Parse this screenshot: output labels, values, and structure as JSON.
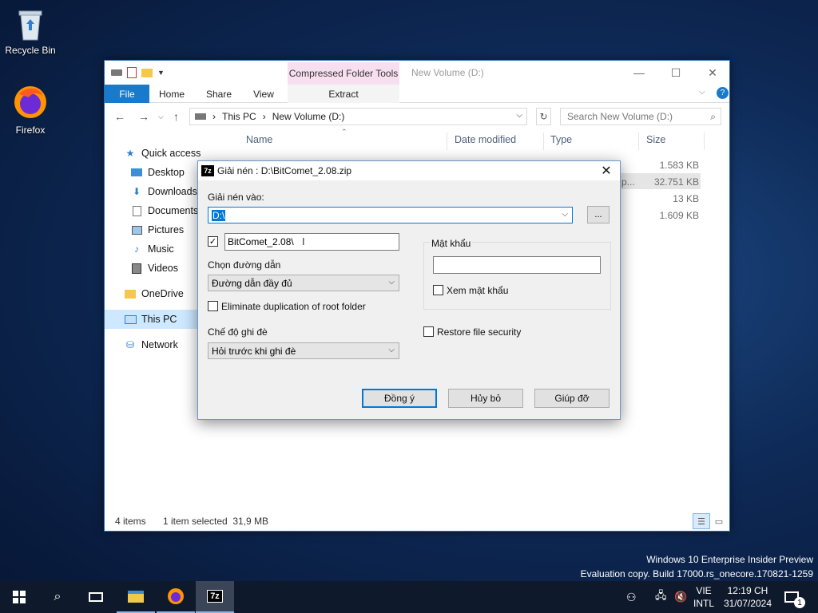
{
  "desktop": {
    "icons": [
      {
        "label": "Recycle Bin",
        "icon": "recycle-bin-icon"
      },
      {
        "label": "Firefox",
        "icon": "firefox-icon"
      }
    ],
    "watermark": {
      "line1": "Windows 10 Enterprise Insider Preview",
      "line2": "Evaluation copy. Build 17000.rs_onecore.170821-1259"
    }
  },
  "explorer": {
    "title": "New Volume (D:)",
    "contextual_tab": "Compressed Folder Tools",
    "ribbon_tabs": [
      "File",
      "Home",
      "Share",
      "View",
      "Extract"
    ],
    "breadcrumb": [
      "This PC",
      "New Volume (D:)"
    ],
    "search_placeholder": "Search New Volume (D:)",
    "nav": [
      "Quick access",
      "Desktop",
      "Downloads",
      "Documents",
      "Pictures",
      "Music",
      "Videos",
      "OneDrive",
      "This PC",
      "Network"
    ],
    "columns": [
      "Name",
      "Date modified",
      "Type",
      "Size"
    ],
    "files": [
      {
        "size": "1.583 KB"
      },
      {
        "size": "32.751 KB",
        "type_fragment": "p..."
      },
      {
        "size": "13 KB"
      },
      {
        "size": "1.609 KB"
      }
    ],
    "status": {
      "items": "4 items",
      "selected": "1 item selected  31,9 MB"
    }
  },
  "dialog": {
    "title": "Giải nén : D:\\BitComet_2.08.zip",
    "extract_to_label": "Giải nén vào:",
    "extract_to_value": "D:\\",
    "browse_label": "...",
    "subfolder_checked": true,
    "subfolder_value": "BitComet_2.08\\",
    "path_mode_label": "Chọn đường dẫn",
    "path_mode_value": "Đường dẫn đầy đủ",
    "eliminate_label": "Eliminate duplication of root folder",
    "overwrite_label": "Chế độ ghi đè",
    "overwrite_value": "Hỏi trước khi ghi đè",
    "password_label": "Mật khẩu",
    "show_password_label": "Xem mật khẩu",
    "restore_security_label": "Restore file security",
    "ok_label": "Đồng ý",
    "cancel_label": "Hủy bỏ",
    "help_label": "Giúp đỡ"
  },
  "taskbar": {
    "lang_top": "VIE",
    "lang_bottom": "INTL",
    "time": "12:19 CH",
    "date": "31/07/2024",
    "notification_count": "1",
    "active_app": "7-Zip",
    "active_app_glyph": "7z"
  }
}
